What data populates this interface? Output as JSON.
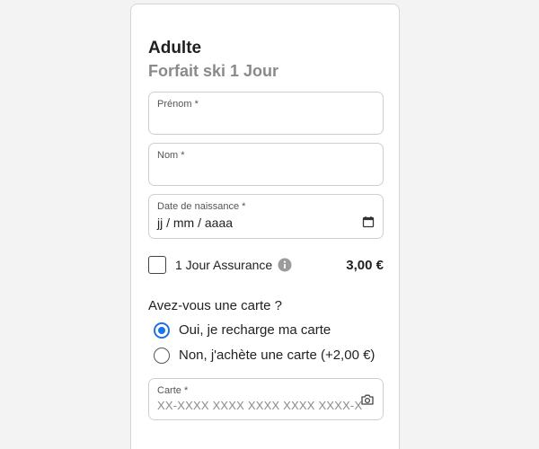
{
  "product": {
    "category": "Adulte",
    "name": "Forfait ski 1 Jour"
  },
  "form": {
    "first_name": {
      "label": "Prénom *",
      "value": ""
    },
    "last_name": {
      "label": "Nom *",
      "value": ""
    },
    "birth_date": {
      "label": "Date de naissance *",
      "value": "jj / mm / aaaa",
      "icon": "calendar-icon"
    },
    "insurance": {
      "label": "1 Jour Assurance",
      "checked": false,
      "price": "3,00 €",
      "icon": "info-icon"
    },
    "card_question": "Avez-vous une carte ?",
    "card_options": [
      {
        "label": "Oui, je recharge ma carte",
        "selected": true
      },
      {
        "label": "Non, j'achète une carte (+2,00 €)",
        "selected": false
      }
    ],
    "card_number": {
      "label": "Carte *",
      "placeholder": "XX-XXXX XXXX XXXX XXXX XXXX-X",
      "icon": "camera-icon"
    }
  },
  "colors": {
    "accent": "#1a73e8",
    "subtitle": "#8a8a8a",
    "border": "#cfcfcf"
  }
}
